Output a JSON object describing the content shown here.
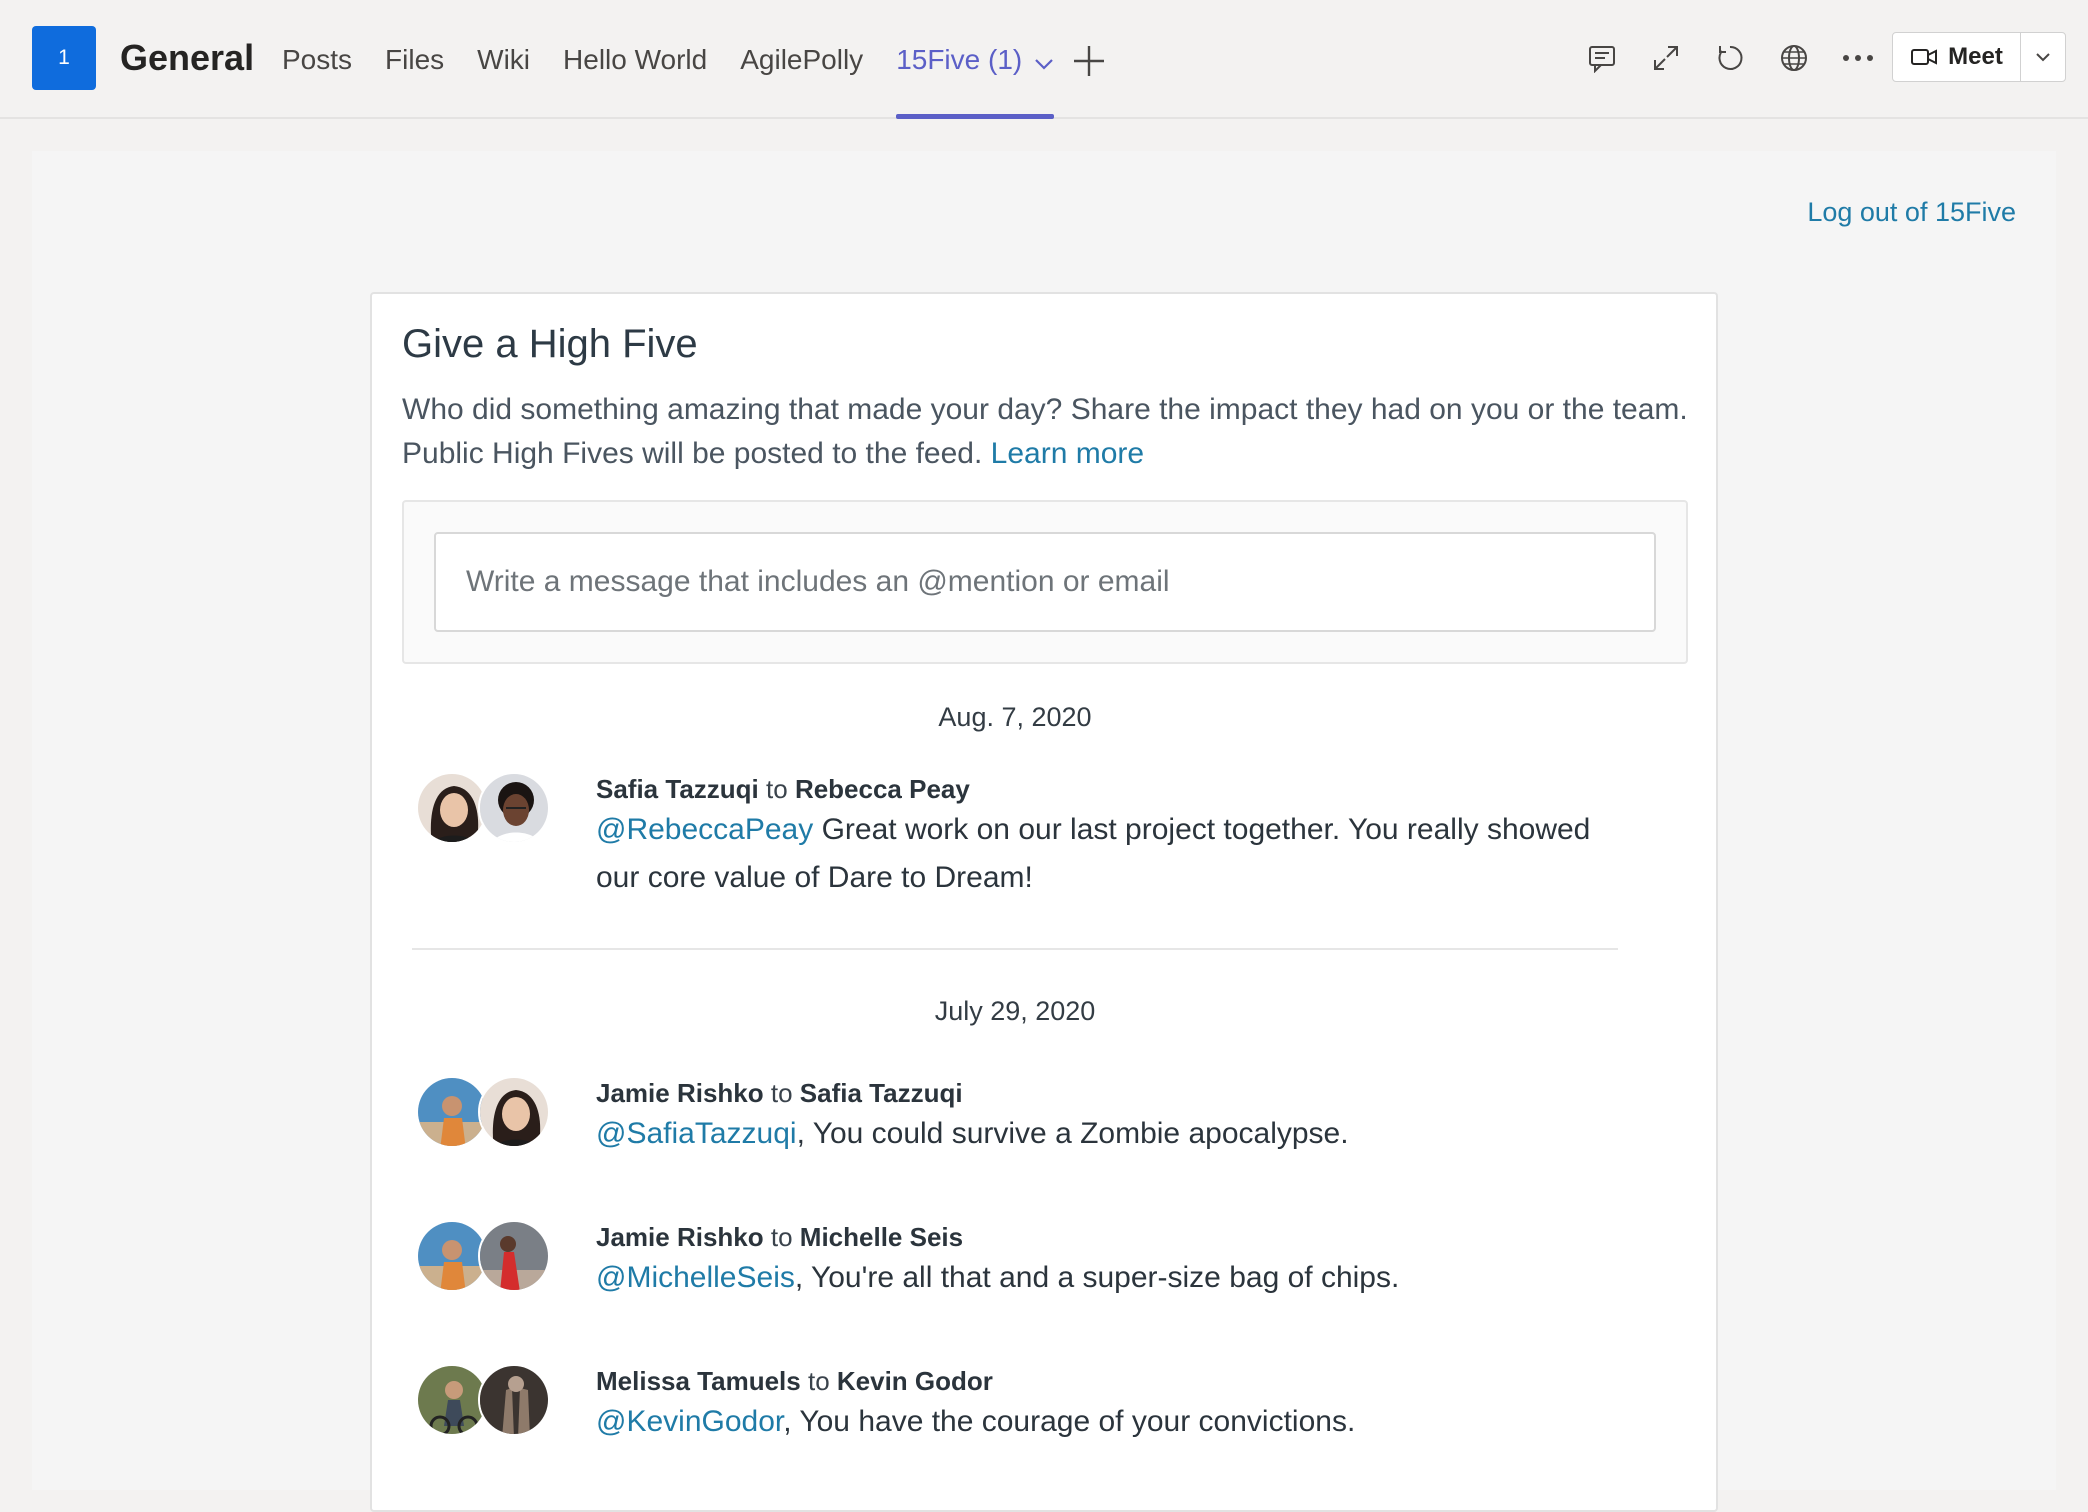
{
  "header": {
    "team_initial": "1",
    "channel": "General",
    "tabs": [
      {
        "label": "Posts"
      },
      {
        "label": "Files"
      },
      {
        "label": "Wiki"
      },
      {
        "label": "Hello World"
      },
      {
        "label": "AgilePolly"
      },
      {
        "label": "15Five (1)",
        "active": true
      }
    ],
    "icons": [
      "conversation-icon",
      "expand-icon",
      "refresh-icon",
      "globe-icon",
      "more-icon"
    ],
    "meet_label": "Meet",
    "accent": "#5b5fc7"
  },
  "app": {
    "logout_label": "Log out of 15Five",
    "title": "Give a High Five",
    "description": "Who did something amazing that made your day? Share the impact they had on you or the team. Public High Fives will be posted to the feed.",
    "learn_more": "Learn more",
    "compose_placeholder": "Write a message that includes an @mention or email",
    "link_color": "#1f7ba7"
  },
  "feed": {
    "groups": [
      {
        "date": "Aug. 7, 2020",
        "entries": [
          {
            "from": "Safia Tazzuqi",
            "connector": "to",
            "to": "Rebecca Peay",
            "mention": "@RebeccaPeay",
            "message": " Great work on our last project together.  You really showed our core value of Dare to Dream!"
          }
        ]
      },
      {
        "date": "July 29, 2020",
        "entries": [
          {
            "from": "Jamie Rishko",
            "connector": "to",
            "to": "Safia Tazzuqi",
            "mention": "@SafiaTazzuqi",
            "message": ", You could survive a Zombie apocalypse."
          },
          {
            "from": "Jamie Rishko",
            "connector": "to",
            "to": "Michelle Seis",
            "mention": "@MichelleSeis",
            "message": ", You're all that and a super-size bag of chips."
          },
          {
            "from": "Melissa Tamuels",
            "connector": "to",
            "to": "Kevin Godor",
            "mention": "@KevinGodor",
            "message": ", You have the courage of your convictions."
          }
        ]
      }
    ]
  }
}
